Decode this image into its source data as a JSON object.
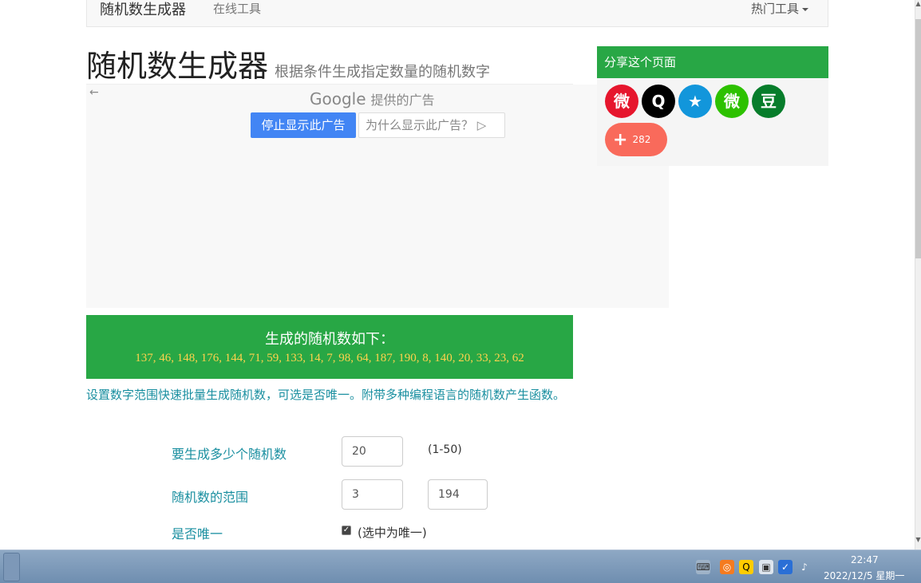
{
  "navbar": {
    "brand": "随机数生成器",
    "link": "在线工具",
    "right": "热门工具"
  },
  "header": {
    "title": "随机数生成器",
    "subtitle": "根据条件生成指定数量的随机数字"
  },
  "ad": {
    "back": "←",
    "google": "Google",
    "provided": "提供的广告",
    "stop_label": "停止显示此广告",
    "why_label": "为什么显示此广告？ ▷"
  },
  "share": {
    "title": "分享这个页面",
    "icons": [
      {
        "name": "weibo-icon",
        "glyph": "微",
        "color": "#e6162d"
      },
      {
        "name": "qq-icon",
        "glyph": "Q",
        "color": "#000000"
      },
      {
        "name": "qzone-icon",
        "glyph": "★",
        "color": "#1296db"
      },
      {
        "name": "wechat-icon",
        "glyph": "微",
        "color": "#2dc100"
      },
      {
        "name": "douban-icon",
        "glyph": "豆",
        "color": "#077d2b"
      }
    ],
    "count": "282"
  },
  "result": {
    "title": "生成的随机数如下：",
    "numbers": "137, 46, 148, 176, 144, 71, 59, 133, 14, 7, 98, 64, 187, 190, 8, 140, 20, 33, 23, 62"
  },
  "description": "设置数字范围快速批量生成随机数，可选是否唯一。附带多种编程语言的随机数产生函数。",
  "form": {
    "count_label": "要生成多少个随机数",
    "count_value": "20",
    "count_hint": "(1-50)",
    "range_label": "随机数的范围",
    "range_min": "3",
    "range_max": "194",
    "unique_label": "是否唯一",
    "unique_checked": true,
    "unique_hint": "(选中为唯一)"
  },
  "taskbar": {
    "time": "22:47",
    "date": "2022/12/5 星期一"
  }
}
